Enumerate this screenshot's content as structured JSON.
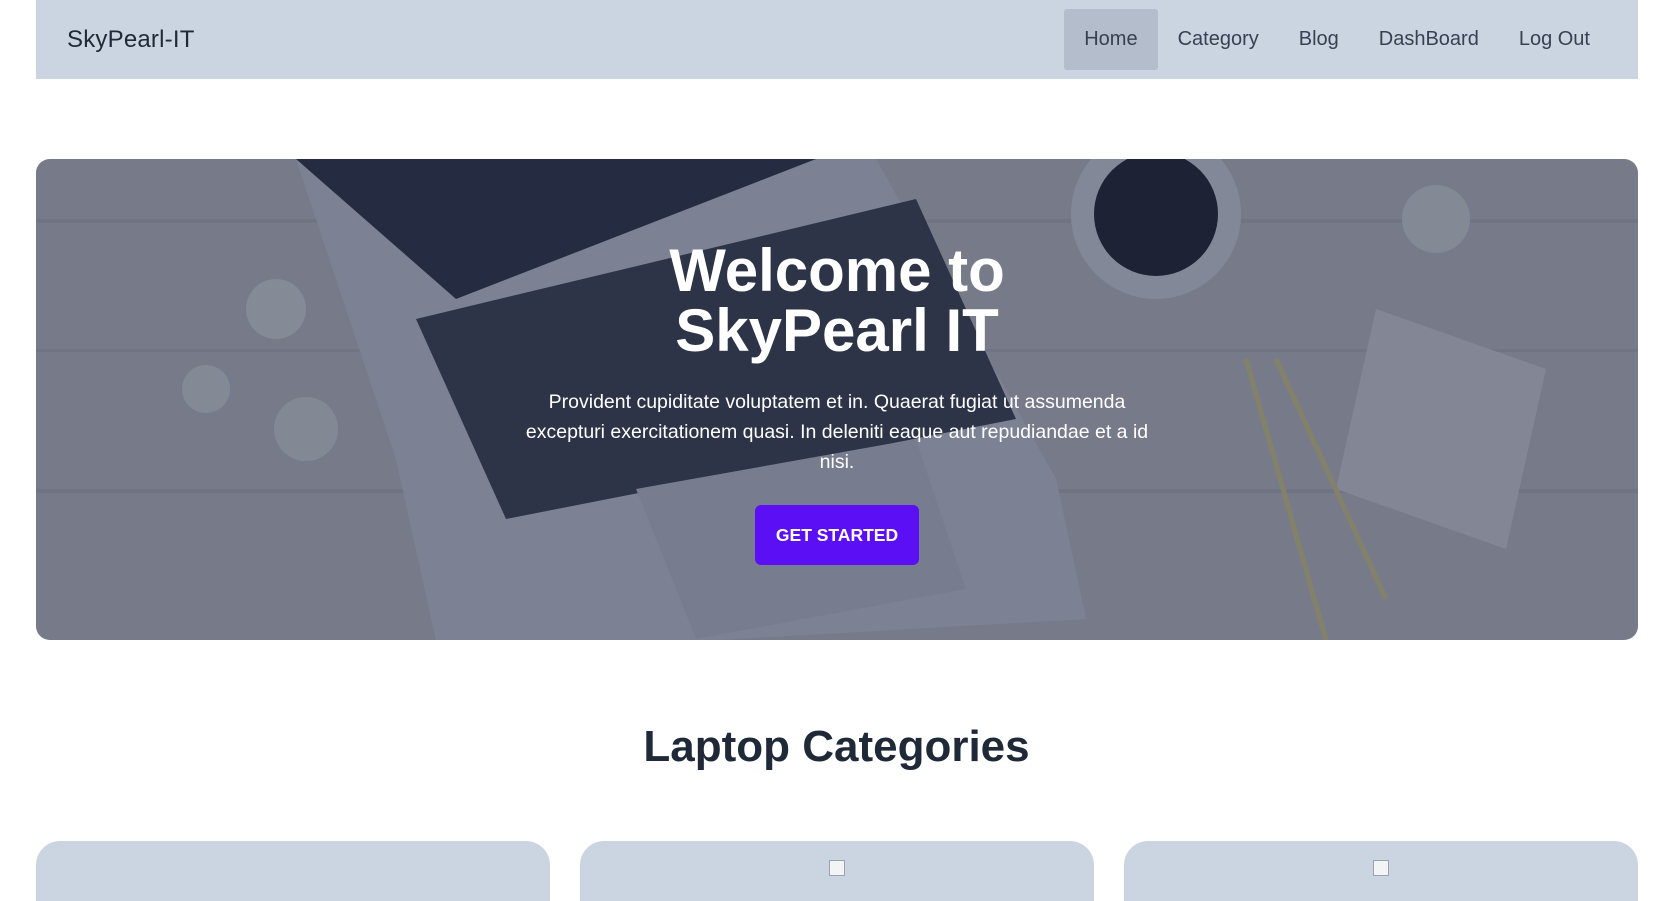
{
  "navbar": {
    "brand": "SkyPearl-IT",
    "items": [
      {
        "label": "Home",
        "active": true
      },
      {
        "label": "Category",
        "active": false
      },
      {
        "label": "Blog",
        "active": false
      },
      {
        "label": "DashBoard",
        "active": false
      },
      {
        "label": "Log Out",
        "active": false
      }
    ]
  },
  "hero": {
    "title_line1": "Welcome to",
    "title_line2": "SkyPearl IT",
    "text": "Provident cupiditate voluptatem et in. Quaerat fugiat ut assumenda excepturi exercitationem quasi. In deleniti eaque aut repudiandae et a id nisi.",
    "cta_label": "GET STARTED",
    "cta_color": "#5b0ff5"
  },
  "categories": {
    "title": "Laptop Categories",
    "cards": [
      {
        "image": "category-image"
      },
      {
        "image": "category-image"
      },
      {
        "image": "category-image"
      }
    ]
  },
  "colors": {
    "navbar_bg": "#cbd5e1",
    "card_bg": "#cbd5e1"
  }
}
